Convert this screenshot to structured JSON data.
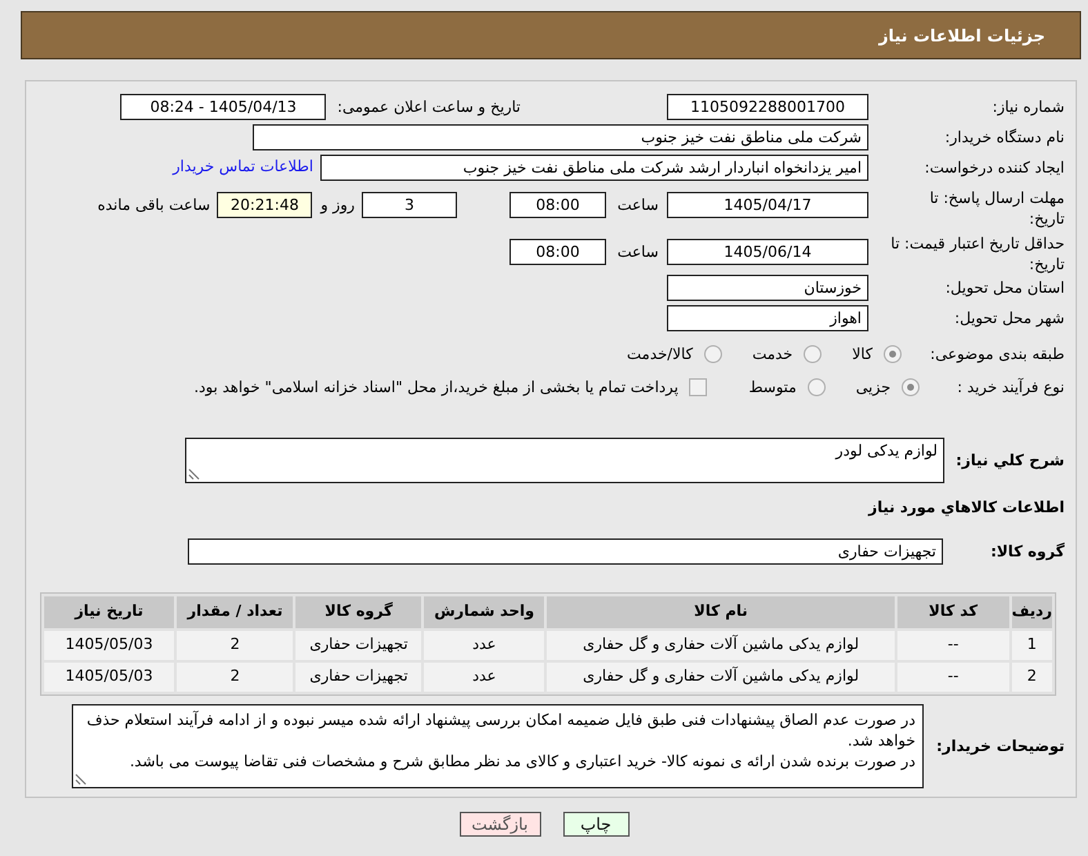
{
  "header": {
    "title": "جزئیات اطلاعات نیاز"
  },
  "need_number": {
    "label": "شماره نیاز:",
    "value": "1105092288001700"
  },
  "announce": {
    "label": "تاریخ و ساعت اعلان عمومی:",
    "value": "1405/04/13 - 08:24"
  },
  "buyer_org": {
    "label": "نام دستگاه خریدار:",
    "value": "شرکت ملی مناطق نفت خیز جنوب"
  },
  "requester": {
    "label": "ایجاد کننده درخواست:",
    "value": "امیر یزدانخواه انباردار ارشد شرکت ملی مناطق نفت خیز جنوب",
    "link": "اطلاعات تماس خریدار"
  },
  "response_deadline": {
    "label": "مهلت ارسال پاسخ: تا تاریخ:",
    "date": "1405/04/17",
    "time_label": "ساعت",
    "time": "08:00",
    "days": "3",
    "days_label": "روز و",
    "remaining": "20:21:48",
    "remaining_label": "ساعت باقی مانده"
  },
  "price_validity": {
    "label": "حداقل تاریخ اعتبار قیمت: تا تاریخ:",
    "date": "1405/06/14",
    "time_label": "ساعت",
    "time": "08:00"
  },
  "province": {
    "label": "استان محل تحویل:",
    "value": "خوزستان"
  },
  "city": {
    "label": "شهر محل تحویل:",
    "value": "اهواز"
  },
  "category": {
    "label": "طبقه بندی موضوعی:",
    "options": [
      {
        "label": "کالا",
        "selected": true
      },
      {
        "label": "خدمت",
        "selected": false
      },
      {
        "label": "کالا/خدمت",
        "selected": false
      }
    ]
  },
  "process": {
    "label": "نوع فرآیند خرید :",
    "options": [
      {
        "label": "جزیی",
        "selected": true
      },
      {
        "label": "متوسط",
        "selected": false
      }
    ],
    "treasury": {
      "label": "پرداخت تمام یا بخشی از مبلغ خرید،از محل \"اسناد خزانه اسلامی\" خواهد بود.",
      "checked": false
    }
  },
  "description": {
    "label": "شرح کلي نياز:",
    "value": "لوازم یدکی لودر"
  },
  "items_heading": "اطلاعات کالاهاي مورد نياز",
  "goods_group": {
    "label": "گروه کالا:",
    "value": "تجهیزات حفاری"
  },
  "table": {
    "columns": [
      "ردیف",
      "کد کالا",
      "نام کالا",
      "واحد شمارش",
      "گروه کالا",
      "تعداد / مقدار",
      "تاریخ نیاز"
    ],
    "rows": [
      [
        "1",
        "--",
        "لوازم یدکی ماشین آلات حفاری و گل حفاری",
        "عدد",
        "تجهیزات حفاری",
        "2",
        "1405/05/03"
      ],
      [
        "2",
        "--",
        "لوازم یدکی ماشین آلات حفاری و گل حفاری",
        "عدد",
        "تجهیزات حفاری",
        "2",
        "1405/05/03"
      ]
    ]
  },
  "buyer_notes": {
    "label": "توضیحات خریدار:",
    "value": "در صورت عدم الصاق پیشنهادات فنی طبق فایل ضمیمه امکان بررسی پیشنهاد ارائه شده میسر نبوده و از ادامه فرآیند استعلام حذف خواهد شد.\nدر صورت برنده شدن ارائه ی نمونه کالا- خرید اعتباری و کالای مد نظر مطابق شرح و مشخصات فنی تقاضا پیوست می باشد."
  },
  "buttons": [
    {
      "label": "چاپ",
      "kind": "print"
    },
    {
      "label": "بازگشت",
      "kind": "back"
    }
  ]
}
